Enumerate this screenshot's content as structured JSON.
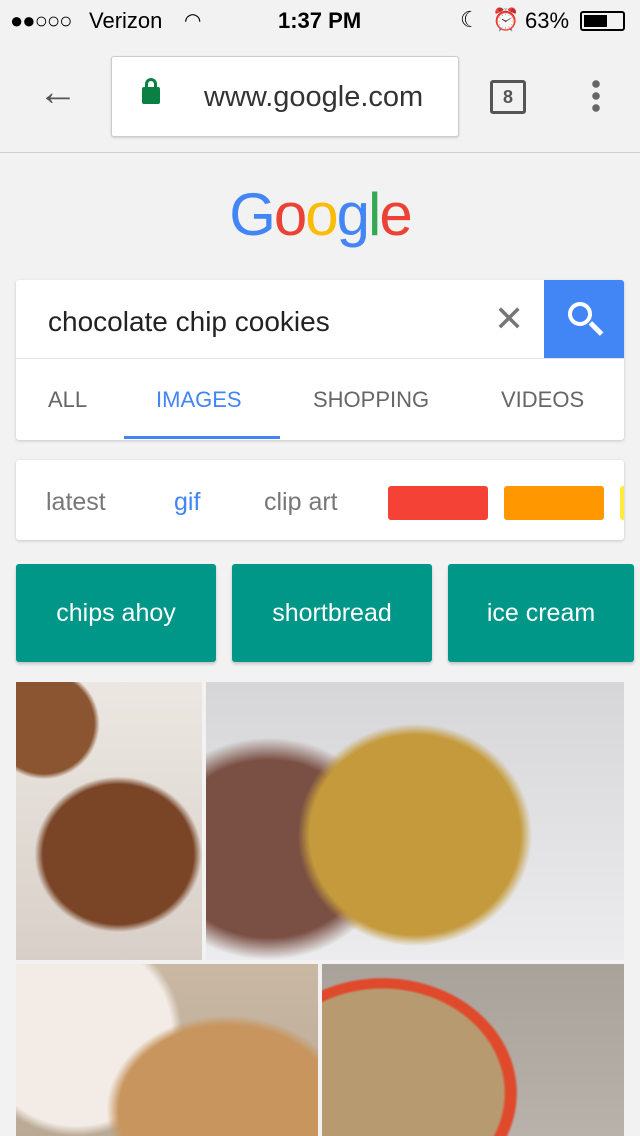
{
  "status": {
    "signal": "●●○○○",
    "carrier": "Verizon",
    "time": "1:37 PM",
    "battery": "63%",
    "battery_level": 0.63
  },
  "browser": {
    "url": "www.google.com",
    "tab_count": "8"
  },
  "logo": "Google",
  "search": {
    "query": "chocolate chip cookies"
  },
  "tabs": [
    {
      "label": "ALL"
    },
    {
      "label": "IMAGES",
      "active": true
    },
    {
      "label": "SHOPPING"
    },
    {
      "label": "VIDEOS"
    }
  ],
  "chips": {
    "items": [
      "latest",
      "gif",
      "clip art"
    ],
    "colors": [
      "#f44336",
      "#ff9800",
      "#ffeb3b"
    ]
  },
  "suggestions": [
    "chips ahoy",
    "shortbread",
    "ice cream"
  ],
  "colors": {
    "accent": "#4285f4",
    "teal": "#009688"
  }
}
